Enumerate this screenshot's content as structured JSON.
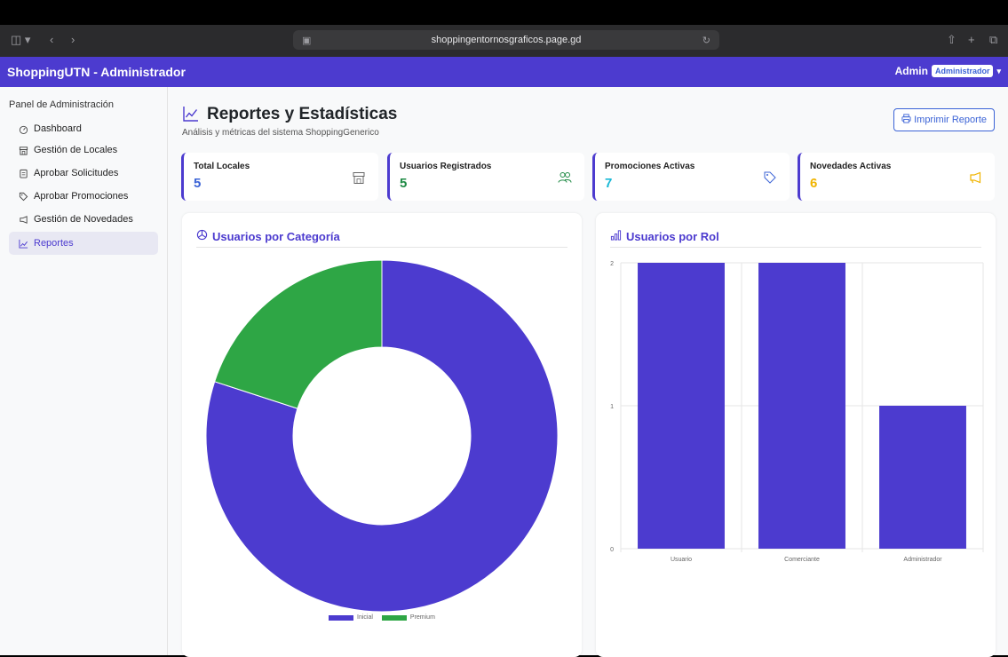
{
  "browser": {
    "url": "shoppingentornosgraficos.page.gd"
  },
  "navbar": {
    "brand": "ShoppingUTN - Administrador",
    "user_name": "Admin",
    "role_badge": "Administrador"
  },
  "sidebar": {
    "title": "Panel de Administración",
    "items": [
      {
        "label": "Dashboard",
        "icon": "speedometer-icon"
      },
      {
        "label": "Gestión de Locales",
        "icon": "shop-icon"
      },
      {
        "label": "Aprobar Solicitudes",
        "icon": "clipboard-icon"
      },
      {
        "label": "Aprobar Promociones",
        "icon": "tag-icon"
      },
      {
        "label": "Gestión de Novedades",
        "icon": "megaphone-icon"
      },
      {
        "label": "Reportes",
        "icon": "chart-line-icon",
        "active": true
      }
    ]
  },
  "header": {
    "title": "Reportes y Estadísticas",
    "subtitle": "Análisis y métricas del sistema ShoppingGenerico",
    "print_label": "Imprimir Reporte"
  },
  "stats": [
    {
      "label": "Total Locales",
      "value": "5",
      "color": "#3b63d6",
      "icon": "shop-icon"
    },
    {
      "label": "Usuarios Registrados",
      "value": "5",
      "color": "#1e8a44",
      "icon": "people-icon"
    },
    {
      "label": "Promociones Activas",
      "value": "7",
      "color": "#19b8d6",
      "icon": "tag-icon"
    },
    {
      "label": "Novedades Activas",
      "value": "6",
      "color": "#f0b400",
      "icon": "megaphone-icon"
    }
  ],
  "colors": {
    "brand": "#4c3bcf",
    "premium": "#2ea645",
    "primary_blue": "#3b63d6"
  },
  "panels": {
    "categories_title": "Usuarios por Categoría",
    "roles_title": "Usuarios por Rol"
  },
  "chart_data": [
    {
      "type": "pie",
      "title": "Usuarios por Categoría",
      "categories": [
        "Inicial",
        "Premium"
      ],
      "values": [
        4,
        1
      ],
      "colors": [
        "#4c3bcf",
        "#2ea645"
      ],
      "donut": true,
      "legend": "bottom"
    },
    {
      "type": "bar",
      "title": "Usuarios por Rol",
      "categories": [
        "Usuario",
        "Comerciante",
        "Administrador"
      ],
      "values": [
        2,
        2,
        1
      ],
      "color": "#4c3bcf",
      "ylim": [
        0,
        2
      ],
      "yticks": [
        0,
        1,
        2
      ],
      "grid": true,
      "legend": "none"
    }
  ]
}
